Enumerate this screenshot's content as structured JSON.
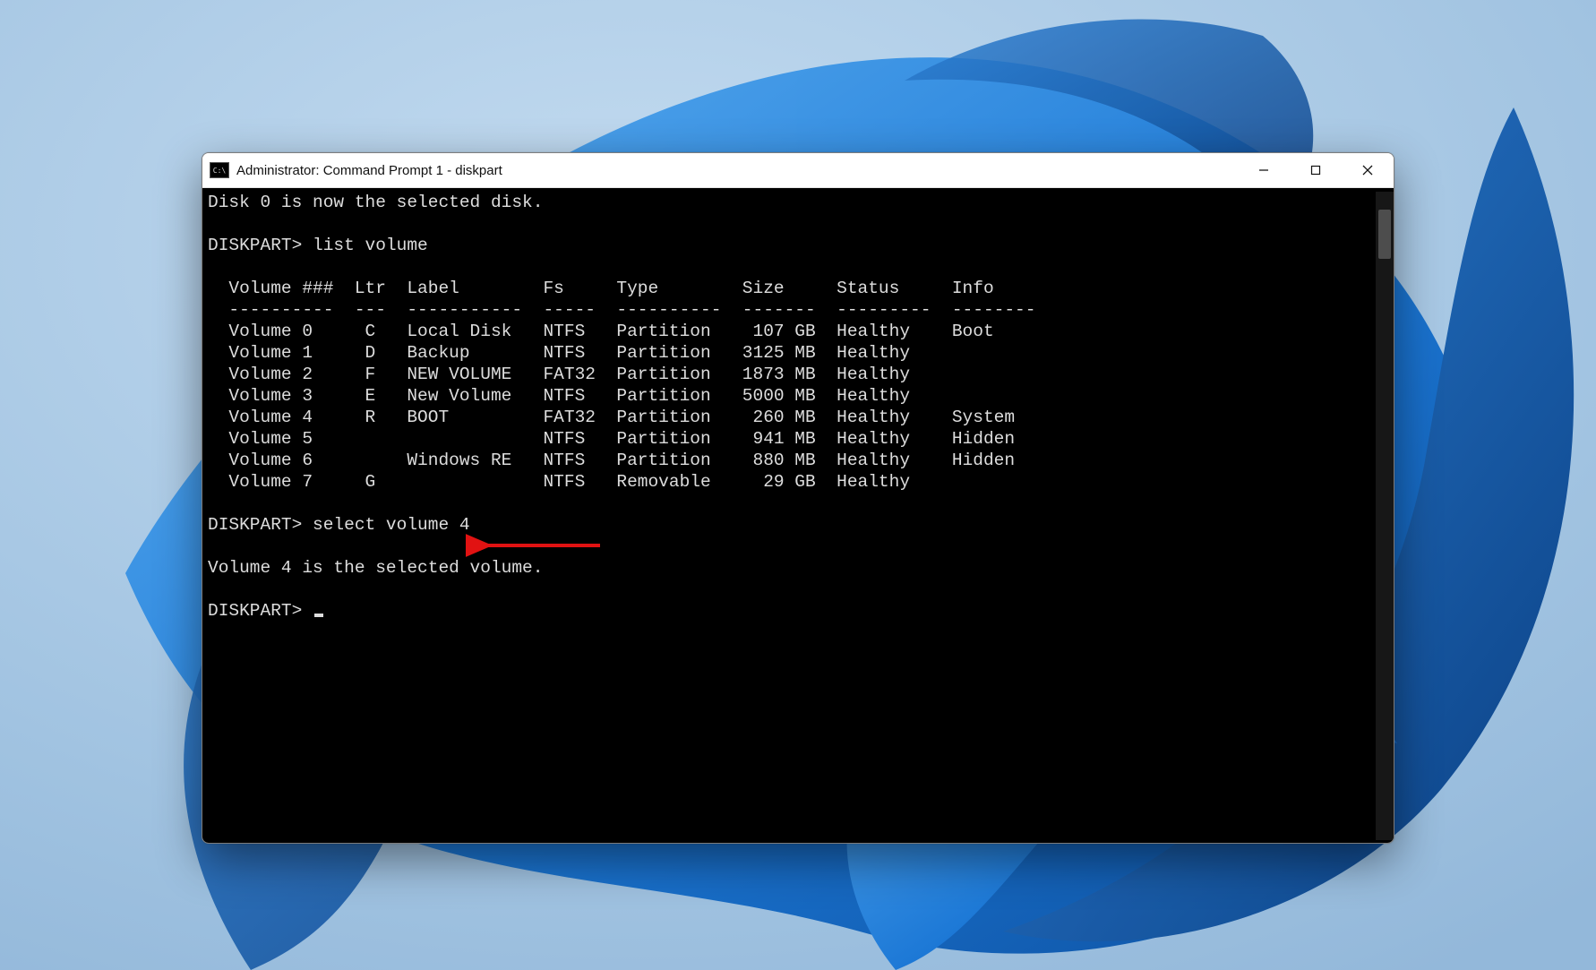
{
  "window": {
    "title": "Administrator: Command Prompt 1 - diskpart"
  },
  "terminal": {
    "line_selected_disk": "Disk 0 is now the selected disk.",
    "prompt": "DISKPART>",
    "cmd_list_volume": "list volume",
    "header": "  Volume ###  Ltr  Label        Fs     Type        Size     Status     Info",
    "divider": "  ----------  ---  -----------  -----  ----------  -------  ---------  --------",
    "volumes": [
      "  Volume 0     C   Local Disk   NTFS   Partition    107 GB  Healthy    Boot",
      "  Volume 1     D   Backup       NTFS   Partition   3125 MB  Healthy",
      "  Volume 2     F   NEW VOLUME   FAT32  Partition   1873 MB  Healthy",
      "  Volume 3     E   New Volume   NTFS   Partition   5000 MB  Healthy",
      "  Volume 4     R   BOOT         FAT32  Partition    260 MB  Healthy    System",
      "  Volume 5                      NTFS   Partition    941 MB  Healthy    Hidden",
      "  Volume 6         Windows RE   NTFS   Partition    880 MB  Healthy    Hidden",
      "  Volume 7     G                NTFS   Removable     29 GB  Healthy"
    ],
    "cmd_select_volume": "select volume 4",
    "result_select": "Volume 4 is the selected volume."
  },
  "annotation": {
    "arrow_color": "#e11212"
  }
}
